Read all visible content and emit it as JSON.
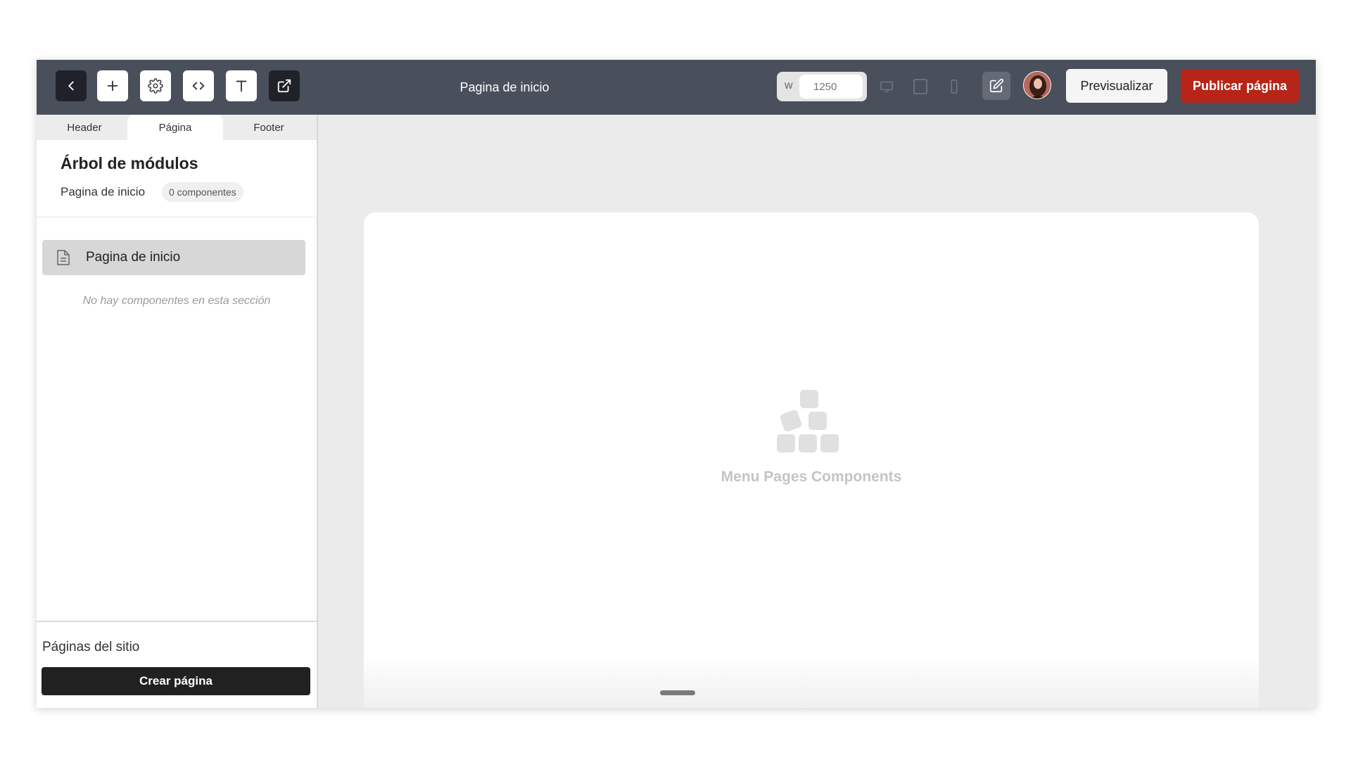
{
  "toolbar": {
    "page_title": "Pagina de inicio",
    "width_label": "w",
    "width_placeholder": "1250",
    "preview_label": "Previsualizar",
    "publish_label": "Publicar página"
  },
  "sidebar": {
    "tabs": [
      {
        "label": "Header",
        "active": false
      },
      {
        "label": "Página",
        "active": true
      },
      {
        "label": "Footer",
        "active": false
      }
    ],
    "tree_title": "Árbol de módulos",
    "tree_page": "Pagina de inicio",
    "component_count": "0 componentes",
    "tree_item_label": "Pagina de inicio",
    "empty_message": "No hay componentes en esta sección",
    "pages_label": "Páginas del sitio",
    "create_button": "Crear página"
  },
  "canvas": {
    "placeholder_text": "Menu Pages Components"
  },
  "colors": {
    "topbar": "#4a4f5c",
    "publish": "#b72418",
    "create_button": "#212121"
  }
}
